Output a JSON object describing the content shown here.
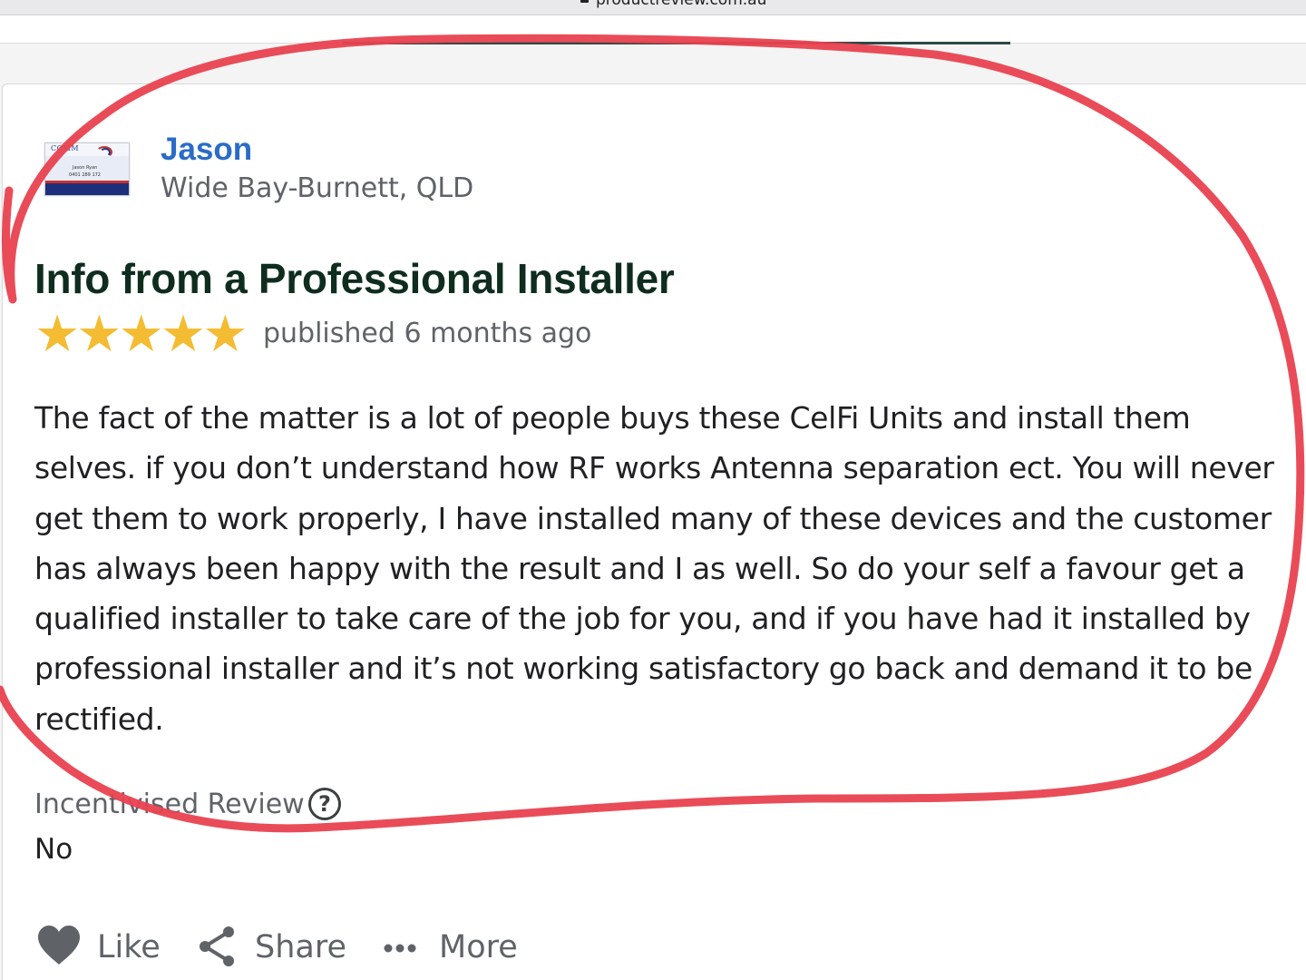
{
  "browser": {
    "url": "productreview.com.au"
  },
  "review": {
    "reviewer_name": "Jason",
    "reviewer_location": "Wide Bay-Burnett, QLD",
    "avatar": {
      "logo_text": "COMM",
      "line1": "Jason Ryan",
      "line2": "0401 289 172"
    },
    "title": "Info from a Professional Installer",
    "rating": 5,
    "max_rating": 5,
    "stars": [
      "★",
      "★",
      "★",
      "★",
      "★"
    ],
    "published": "published 6 months ago",
    "body_lines": [
      "The fact of the matter is a lot of people buys these CelFi Units and install them",
      "selves. if you don’t understand how RF works Antenna separation ect. You will never",
      "get them to work properly, I have installed many of these devices and the customer",
      "has always been happy with the result and I as well. So do your self a favour get a",
      "qualified installer to take care of the job for you, and if you have had it installed by",
      "professional installer and it’s not working satisfactory go back and demand it to be",
      "rectified."
    ],
    "incentivised_label": "Incentivised Review",
    "incentivised_help": "?",
    "incentivised_value": "No"
  },
  "actions": {
    "like_label": "Like",
    "share_label": "Share",
    "more_label": "More"
  },
  "colors": {
    "reviewer_name": "#2a6cc7",
    "title": "#0f2d1e",
    "star": "#f4bc32",
    "annotation_ellipse": "#e8424f",
    "tab_indicator": "#2c4a45"
  },
  "icons": {
    "like": "heart-icon",
    "share": "share-icon",
    "more": "ellipsis-icon",
    "help": "question-circle-icon"
  }
}
